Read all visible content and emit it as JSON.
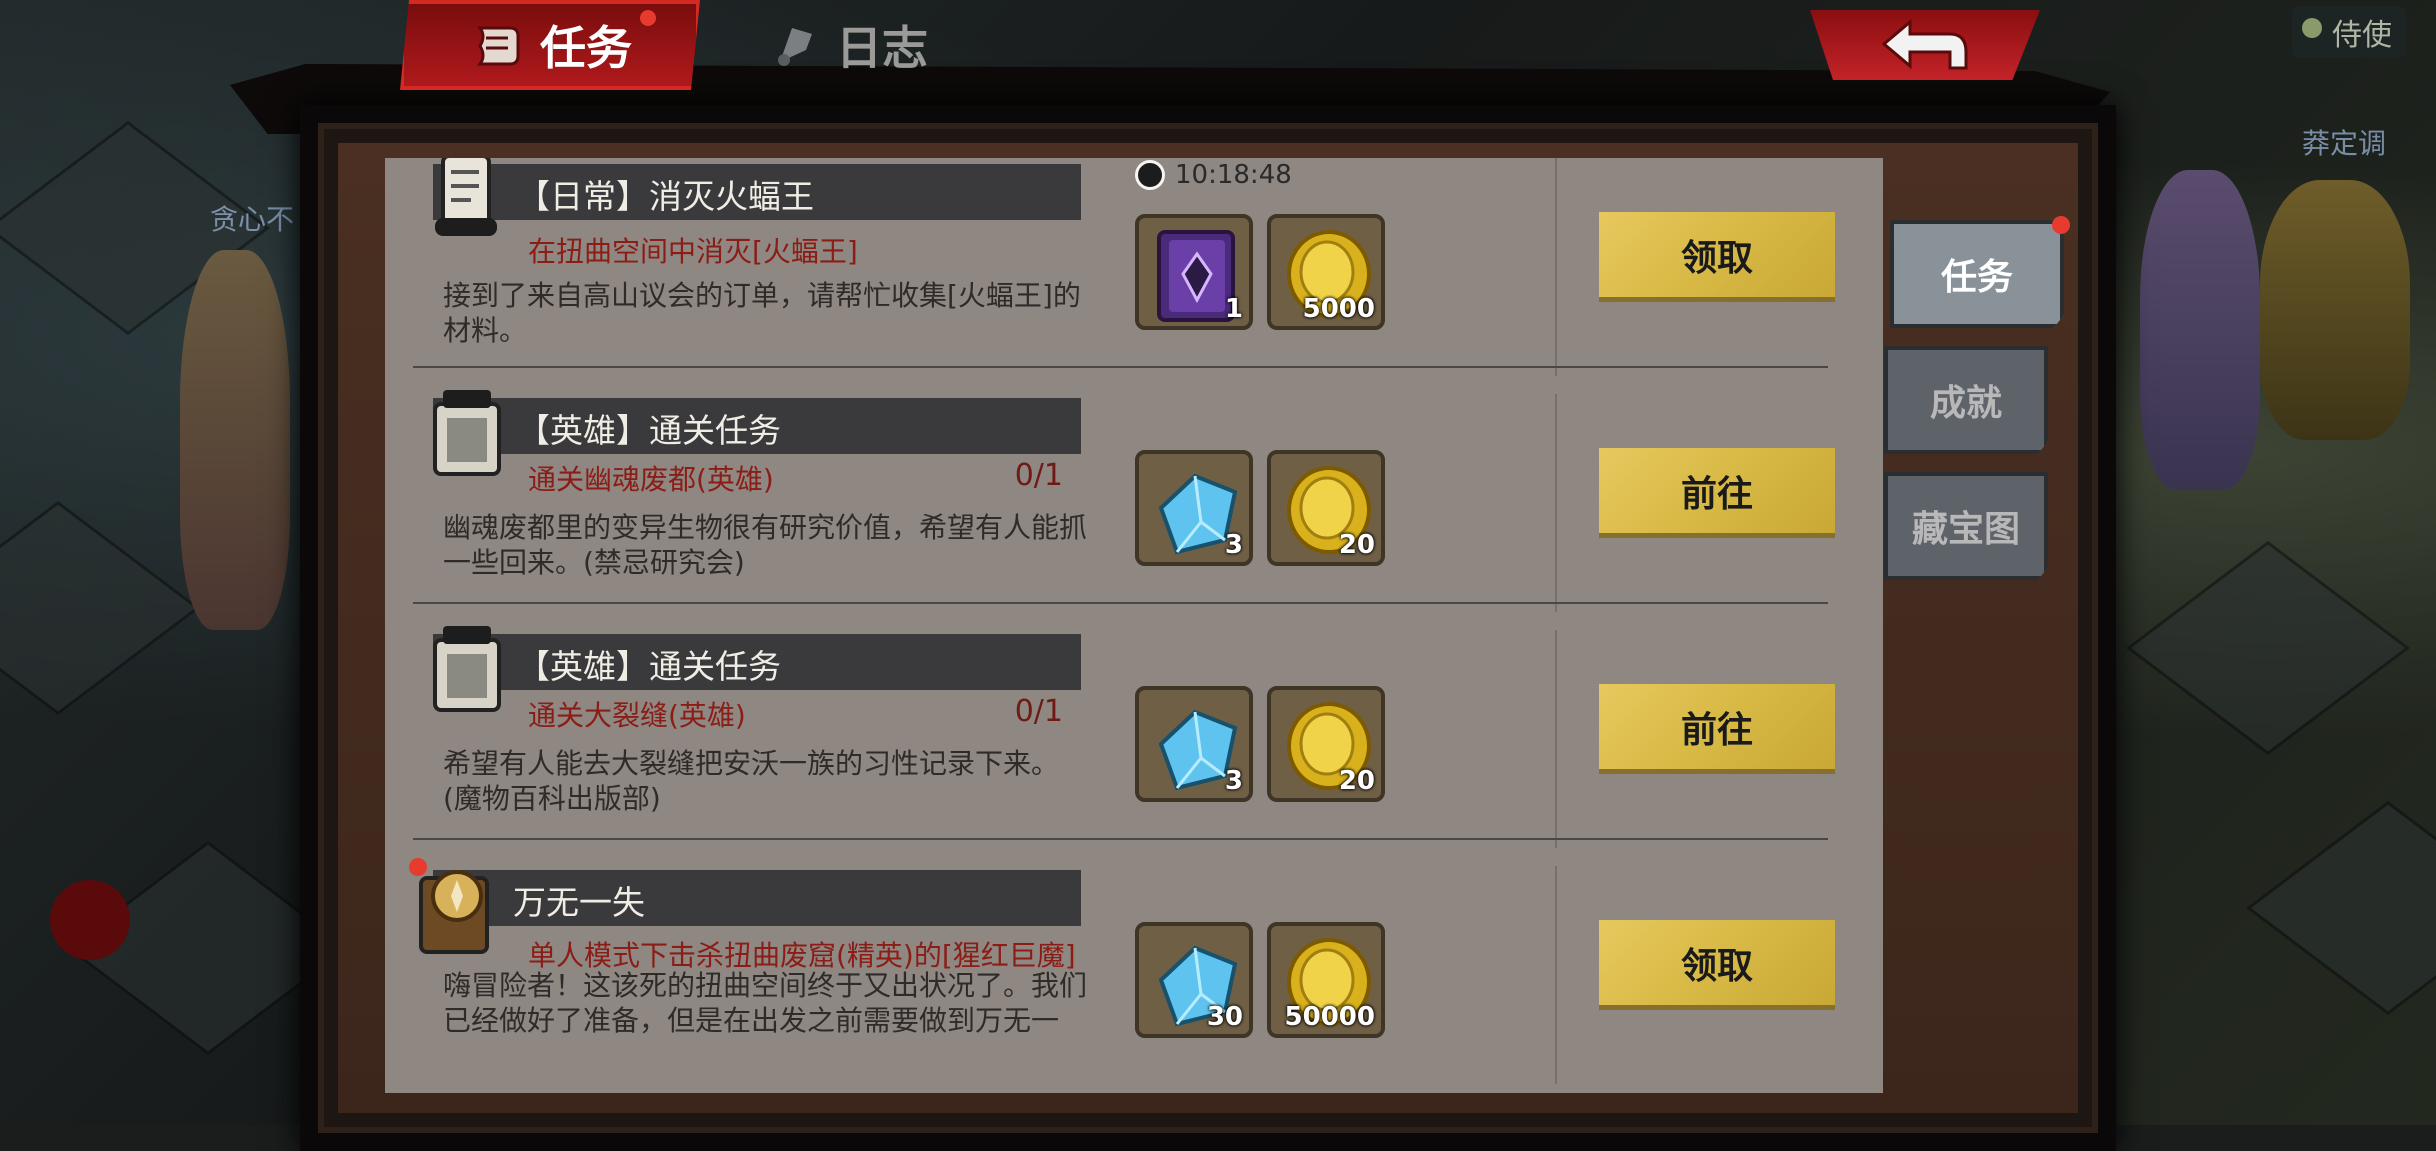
{
  "header": {
    "tabs": [
      {
        "label": "任务",
        "active": true,
        "icon": "scroll-icon"
      },
      {
        "label": "日志",
        "active": false,
        "icon": "flag-icon"
      }
    ],
    "top_right_hint": "侍使",
    "back_icon": "back-arrow-icon"
  },
  "background": {
    "left_label": "贪心不",
    "right_label": "莽定调"
  },
  "quests": [
    {
      "title": "【日常】消灭火蝠王",
      "icon": "scroll-icon",
      "timer": "10:18:48",
      "objective": "在扭曲空间中消灭[火蝠王]",
      "progress": "",
      "description": "接到了来自高山议会的订单，请帮忙收集[火蝠王]的材料。",
      "rewards": [
        {
          "item": "purple-book-icon",
          "count": "1"
        },
        {
          "item": "gold-coin-icon",
          "count": "5000"
        }
      ],
      "button": "领取"
    },
    {
      "title": "【英雄】通关任务",
      "icon": "notice-board-icon",
      "timer": "",
      "objective": "通关幽魂废都(英雄)",
      "progress": "0/1",
      "description": "幽魂废都里的变异生物很有研究价值，希望有人能抓一些回来。(禁忌研究会)",
      "rewards": [
        {
          "item": "blue-crystal-icon",
          "count": "3"
        },
        {
          "item": "gold-coin-icon",
          "count": "20"
        }
      ],
      "button": "前往"
    },
    {
      "title": "【英雄】通关任务",
      "icon": "notice-board-icon",
      "timer": "",
      "objective": "通关大裂缝(英雄)",
      "progress": "0/1",
      "description": "希望有人能去大裂缝把安沃一族的习性记录下来。(魔物百科出版部)",
      "rewards": [
        {
          "item": "blue-crystal-icon",
          "count": "3"
        },
        {
          "item": "gold-coin-icon",
          "count": "20"
        }
      ],
      "button": "前往"
    },
    {
      "title": "万无一失",
      "icon": "compass-book-icon",
      "timer": "",
      "objective": "单人模式下击杀扭曲废窟(精英)的[猩红巨魔]",
      "progress": "",
      "description": "嗨冒险者！这该死的扭曲空间终于又出状况了。我们已经做好了准备，但是在出发之前需要做到万无一失，麻烦你先把[猩红巨魔]解决掉吧!(单人击败精英难度[",
      "rewards": [
        {
          "item": "blue-crystal-icon",
          "count": "30"
        },
        {
          "item": "gold-coin-icon",
          "count": "50000"
        }
      ],
      "button": "领取"
    }
  ],
  "side_tabs": [
    {
      "label": "任务",
      "active": true
    },
    {
      "label": "成就",
      "active": false
    },
    {
      "label": "藏宝图",
      "active": false
    }
  ],
  "colors": {
    "accent_red": "#b0191c",
    "button_gold": "#d8b945",
    "panel_bg": "#8e8782",
    "objective_red": "#8c1d16"
  }
}
